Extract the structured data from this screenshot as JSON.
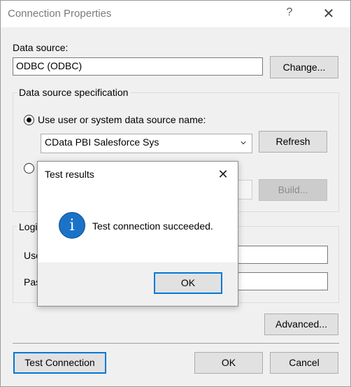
{
  "window": {
    "title": "Connection Properties",
    "help_symbol": "?",
    "close_symbol": "✕"
  },
  "data_source": {
    "label": "Data source:",
    "value": "ODBC (ODBC)",
    "change_button": "Change..."
  },
  "spec": {
    "group_title": "Data source specification",
    "use_dsn_label": "Use user or system data source name:",
    "dsn_selected": "CData PBI Salesforce Sys",
    "refresh_button": "Refresh",
    "build_button": "Build..."
  },
  "login": {
    "group_title": "Logi",
    "user_label": "Use",
    "password_label": "Pas"
  },
  "buttons": {
    "advanced": "Advanced...",
    "test_connection": "Test Connection",
    "ok": "OK",
    "cancel": "Cancel"
  },
  "modal": {
    "title": "Test results",
    "close_symbol": "✕",
    "message": "Test connection succeeded.",
    "icon_glyph": "i",
    "ok_button": "OK"
  }
}
